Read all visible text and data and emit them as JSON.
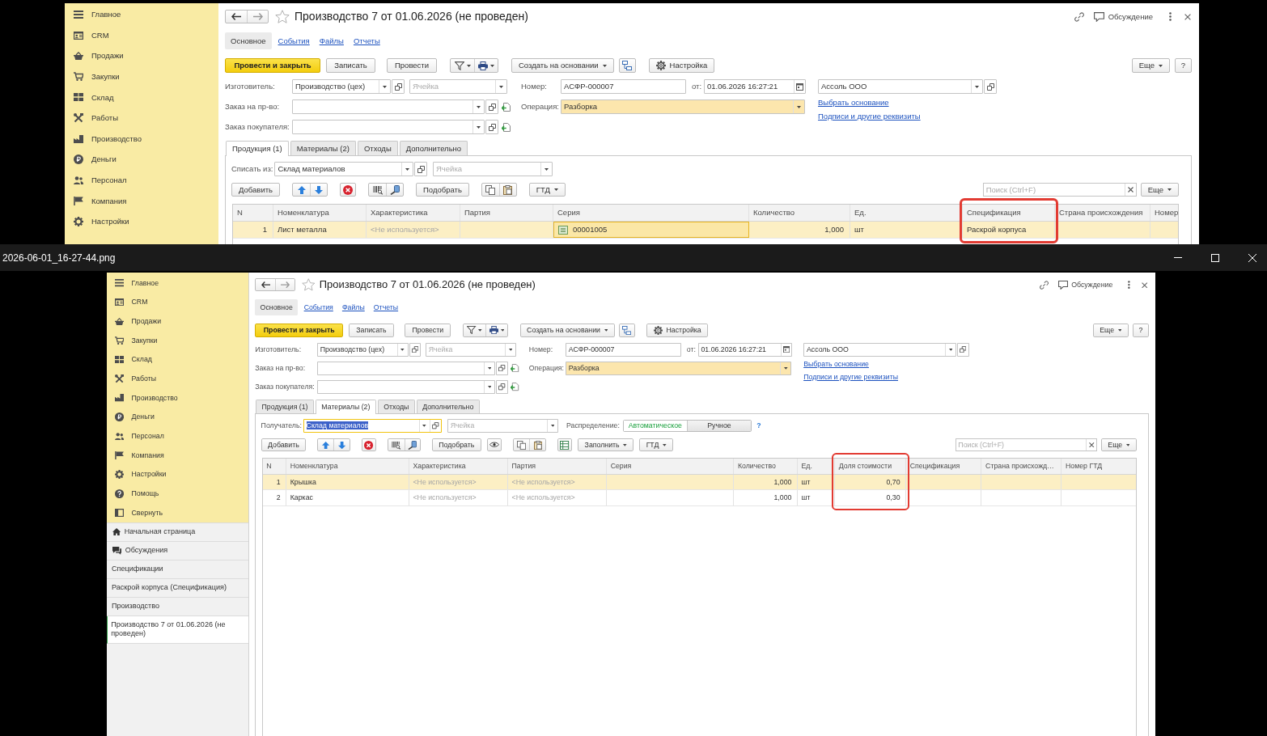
{
  "background_window": {
    "sidebar": {
      "items": [
        "Главное",
        "CRM",
        "Продажи",
        "Закупки",
        "Склад",
        "Работы",
        "Производство",
        "Деньги",
        "Персонал",
        "Компания",
        "Настройки"
      ]
    },
    "form": {
      "title": "Производство 7 от 01.06.2026 (не проведен)",
      "discussion": "Обсуждение",
      "sections": [
        {
          "label": "Основное",
          "selected": true
        },
        {
          "label": "События",
          "selected": false
        },
        {
          "label": "Файлы",
          "selected": false
        },
        {
          "label": "Отчеты",
          "selected": false
        }
      ],
      "commands": {
        "post_and_close": "Провести и закрыть",
        "save": "Записать",
        "post": "Провести",
        "create_based_on": "Создать на основании",
        "settings": "Настройка",
        "more": "Еще",
        "help": "?"
      },
      "fields": {
        "manufacturer": {
          "label": "Изготовитель:",
          "value": "Производство (цех)"
        },
        "manufacturer_cell": {
          "placeholder": "Ячейка"
        },
        "number": {
          "label": "Номер:",
          "value": "АСФР-000007"
        },
        "date": {
          "label": "от:",
          "value": "01.06.2026 16:27:21"
        },
        "organization": {
          "value": "Ассоль ООО"
        },
        "production_order": {
          "label": "Заказ на пр-во:"
        },
        "operation": {
          "label": "Операция:",
          "value": "Разборка"
        },
        "customer_order": {
          "label": "Заказ покупателя:"
        }
      },
      "links": [
        "Выбрать основание",
        "Подписи и другие реквизиты"
      ],
      "tabs": [
        {
          "label": "Продукция (1)",
          "selected": true
        },
        {
          "label": "Материалы (2)",
          "selected": false
        },
        {
          "label": "Отходы",
          "selected": false
        },
        {
          "label": "Дополнительно",
          "selected": false
        }
      ],
      "panel": {
        "warehouse": {
          "label": "Списать из:",
          "value": "Склад материалов",
          "focused": false
        },
        "cell": {
          "placeholder": "Ячейка"
        },
        "toolbar": [
          {
            "kind": "button",
            "label": "Добавить"
          },
          {
            "kind": "arrows"
          },
          {
            "kind": "delete"
          },
          {
            "kind": "scan"
          },
          {
            "kind": "button",
            "label": "Подобрать"
          },
          {
            "kind": "copy"
          },
          {
            "kind": "menu",
            "label": "ГТД"
          }
        ],
        "search": {
          "placeholder": "Поиск (Ctrl+F)"
        },
        "more": "Еще",
        "table": {
          "columns": [
            {
              "label": "N",
              "kind": "number",
              "highlighted": false
            },
            {
              "label": "Номенклатура",
              "kind": "text",
              "highlighted": false
            },
            {
              "label": "Характеристика",
              "kind": "text",
              "highlighted": false
            },
            {
              "label": "Партия",
              "kind": "text",
              "highlighted": false
            },
            {
              "label": "Серия",
              "kind": "text",
              "highlighted": false
            },
            {
              "label": "Количество",
              "kind": "number",
              "highlighted": false
            },
            {
              "label": "Ед.",
              "kind": "text",
              "highlighted": false
            },
            {
              "label": "Спецификация",
              "kind": "text",
              "highlighted": true
            },
            {
              "label": "Страна происхождения",
              "kind": "text",
              "highlighted": false
            },
            {
              "label": "Номер",
              "kind": "text",
              "highlighted": false
            }
          ],
          "rows": [
            {
              "selected": true,
              "cells": [
                "1",
                "Лист металла",
                {
                  "text": "<Не используется>",
                  "muted": true
                },
                null,
                {
                  "text": "00001005",
                  "editing": true
                },
                "1,000",
                "шт",
                "Раскрой корпуса",
                null,
                null
              ]
            }
          ]
        }
      }
    }
  },
  "image_viewer": {
    "title": "2026-06-01_16-27-44.png",
    "screenshot": {
      "sidebar": {
        "items": [
          "Главное",
          "CRM",
          "Продажи",
          "Закупки",
          "Склад",
          "Работы",
          "Производство",
          "Деньги",
          "Персонал",
          "Компания",
          "Настройки",
          "Помощь",
          "Свернуть"
        ]
      },
      "open_windows": [
        {
          "kind": "home",
          "label": "Начальная страница",
          "selected": false
        },
        {
          "kind": "discussions",
          "label": "Обсуждения",
          "selected": false
        },
        {
          "kind": "page",
          "label": "Спецификации",
          "selected": false
        },
        {
          "kind": "page",
          "label": "Раскрой корпуса (Спецификация)",
          "selected": false
        },
        {
          "kind": "page",
          "label": "Производство",
          "selected": false
        },
        {
          "kind": "page",
          "label": "Производство 7 от 01.06.2026 (не проведен)",
          "selected": true
        }
      ],
      "form": {
        "title": "Производство 7 от 01.06.2026 (не проведен)",
        "discussion": "Обсуждение",
        "sections": [
          {
            "label": "Основное",
            "selected": true
          },
          {
            "label": "События",
            "selected": false
          },
          {
            "label": "Файлы",
            "selected": false
          },
          {
            "label": "Отчеты",
            "selected": false
          }
        ],
        "commands": {
          "post_and_close": "Провести и закрыть",
          "save": "Записать",
          "post": "Провести",
          "create_based_on": "Создать на основании",
          "settings": "Настройка",
          "more": "Еще",
          "help": "?"
        },
        "fields": {
          "manufacturer": {
            "label": "Изготовитель:",
            "value": "Производство (цех)"
          },
          "manufacturer_cell": {
            "placeholder": "Ячейка"
          },
          "number": {
            "label": "Номер:",
            "value": "АСФР-000007"
          },
          "date": {
            "label": "от:",
            "value": "01.06.2026 16:27:21"
          },
          "organization": {
            "value": "Ассоль ООО"
          },
          "production_order": {
            "label": "Заказ на пр-во:"
          },
          "operation": {
            "label": "Операция:",
            "value": "Разборка"
          },
          "customer_order": {
            "label": "Заказ покупателя:"
          }
        },
        "links": [
          "Выбрать основание",
          "Подписи и другие реквизиты"
        ],
        "tabs": [
          {
            "label": "Продукция (1)",
            "selected": false
          },
          {
            "label": "Материалы (2)",
            "selected": true
          },
          {
            "label": "Отходы",
            "selected": false
          },
          {
            "label": "Дополнительно",
            "selected": false
          }
        ],
        "panel": {
          "warehouse": {
            "label": "Получатель:",
            "value": "Склад материалов",
            "focused": true
          },
          "cell": {
            "placeholder": "Ячейка"
          },
          "distribution": {
            "label": "Распределение:",
            "options": [
              {
                "label": "Автоматическое",
                "selected": true
              },
              {
                "label": "Ручное",
                "selected": false
              }
            ],
            "help": "?"
          },
          "toolbar": [
            {
              "kind": "button",
              "label": "Добавить"
            },
            {
              "kind": "arrows"
            },
            {
              "kind": "delete"
            },
            {
              "kind": "scan"
            },
            {
              "kind": "button",
              "label": "Подобрать"
            },
            {
              "kind": "eye"
            },
            {
              "kind": "copy"
            },
            {
              "kind": "excel"
            },
            {
              "kind": "menu",
              "label": "Заполнить"
            },
            {
              "kind": "menu",
              "label": "ГТД"
            }
          ],
          "search": {
            "placeholder": "Поиск (Ctrl+F)"
          },
          "more": "Еще",
          "table": {
            "columns": [
              {
                "label": "N",
                "kind": "number",
                "highlighted": false
              },
              {
                "label": "Номенклатура",
                "kind": "text",
                "highlighted": false
              },
              {
                "label": "Характеристика",
                "kind": "text",
                "highlighted": false
              },
              {
                "label": "Партия",
                "kind": "text",
                "highlighted": false
              },
              {
                "label": "Серия",
                "kind": "text",
                "highlighted": false
              },
              {
                "label": "Количество",
                "kind": "number",
                "highlighted": false
              },
              {
                "label": "Ед.",
                "kind": "text",
                "highlighted": false
              },
              {
                "label": "Доля стоимости",
                "kind": "number",
                "highlighted": true
              },
              {
                "label": "Спецификация",
                "kind": "text",
                "highlighted": false
              },
              {
                "label": "Страна происхожд…",
                "kind": "text",
                "highlighted": false
              },
              {
                "label": "Номер ГТД",
                "kind": "text",
                "highlighted": false
              }
            ],
            "rows": [
              {
                "selected": true,
                "cells": [
                  "1",
                  "Крышка",
                  {
                    "text": "<Не используется>",
                    "muted": true
                  },
                  {
                    "text": "<Не используется>",
                    "muted": true
                  },
                  null,
                  "1,000",
                  "шт",
                  "0,70",
                  null,
                  null,
                  null
                ]
              },
              {
                "selected": false,
                "cells": [
                  "2",
                  "Каркас",
                  {
                    "text": "<Не используется>",
                    "muted": true
                  },
                  {
                    "text": "<Не используется>",
                    "muted": true
                  },
                  null,
                  "1,000",
                  "шт",
                  "0,30",
                  null,
                  null,
                  null
                ]
              }
            ]
          }
        }
      }
    }
  }
}
